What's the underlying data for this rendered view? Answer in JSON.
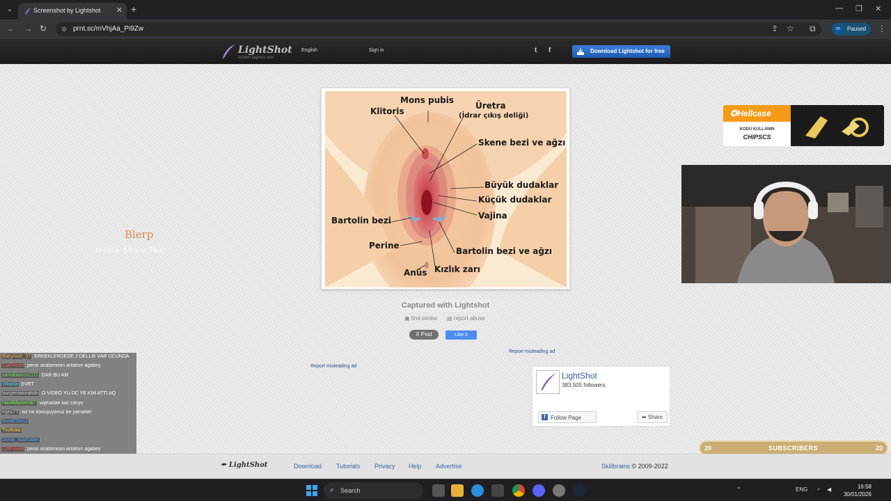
{
  "browser": {
    "tab_title": "Screenshot by Lightshot",
    "url": "prnt.sc/mVhjAa_Pi9Zw",
    "profile_initial": "m",
    "profile_status": "Paused"
  },
  "site": {
    "logo_name": "LightShot",
    "logo_tagline": "screen capture tool",
    "language": "English",
    "signin": "Sign in",
    "download_btn": "Download Lightshot for free"
  },
  "diagram_labels": {
    "mons": "Mons pubis",
    "klitoris": "Klitoris",
    "uretra": "Üretra",
    "uretra_sub": "(İdrar çıkış deliği)",
    "skene": "Skene bezi ve ağzı",
    "buyuk": "Büyük dudaklar",
    "kucuk": "Küçük dudaklar",
    "vajina": "Vajina",
    "bartolin": "Bartolin bezi",
    "perine": "Perine",
    "bartolin_agiz": "Bartolin bezi ve ağzı",
    "kizlik": "Kızlık zarı",
    "anus": "Anüs"
  },
  "captured": "Captured with Lightshot",
  "find_similar": "find similar",
  "report_abuse": "report abuse",
  "xpost": "X Post",
  "fblike": "Like 0",
  "report_misleading_1": "Report misleading ad",
  "report_misleading_2": "Report misleading ad",
  "blerp": {
    "title": "Blerp",
    "subtitle": "Media Share Text"
  },
  "fb_widget": {
    "page_name": "LightShot",
    "followers": "383,505 followers",
    "follow": "Follow Page",
    "share": "Share"
  },
  "hellcase": {
    "brand": "Hellcase",
    "kodu": "KODU KULLANIN",
    "code": "CHIPSCS"
  },
  "chat": [
    {
      "user": "Baeyrvon_97",
      "msg": ": ERKEKLERDEDE 2 DELLİK VAR UCUNDA",
      "color": "#ffb14a"
    },
    {
      "user": "CptPrloed",
      "msg": ": penis anatomisini anlatsın agabey",
      "color": "#ff5a5a"
    },
    {
      "user": "santablanca1111",
      "msg": ": DAR BU AM",
      "color": "#7ddc5b"
    },
    {
      "user": "Vitlanla",
      "msg": ": EVET",
      "color": "#4fd3ff"
    },
    {
      "user": "bunyemekealsibi",
      "msg": ": O VIDEO YU DC YE KIM ATTI AQ",
      "color": "#cfcfcf"
    },
    {
      "user": "HavkMasters67",
      "msg": ": vajinadan kac cıkıyo",
      "color": "#7dff4a"
    },
    {
      "user": "egeo77",
      "msg": ": siz ne konuşuyonuz be yarrakler",
      "color": "#cfcfcf"
    },
    {
      "user": "BurakYavuz",
      "msg": ": ",
      "color": "#4fa3ff"
    },
    {
      "user": "Tirotkala",
      "msg": ": ",
      "color": "#ffd84a"
    },
    {
      "user": "Doruk_Alamadar",
      "msg": ": ",
      "color": "#4fa3ff"
    },
    {
      "user": "CptPrloed",
      "msg": ": penis anatomisini anlatsın agabey",
      "color": "#ff5a5a"
    }
  ],
  "subscribers": {
    "left": "20",
    "label": "SUBSCRIBERS",
    "right": "20"
  },
  "footer": {
    "logo": "LightShot",
    "download": "Download",
    "tutorials": "Tutorials",
    "privacy": "Privacy",
    "help": "Help",
    "advertise": "Advertise",
    "company": "Skillbrains",
    "copyright": "© 2009-2022"
  },
  "taskbar": {
    "search": "Search",
    "lang": "ENG",
    "time": "16:58",
    "date": "30/01/2026"
  }
}
